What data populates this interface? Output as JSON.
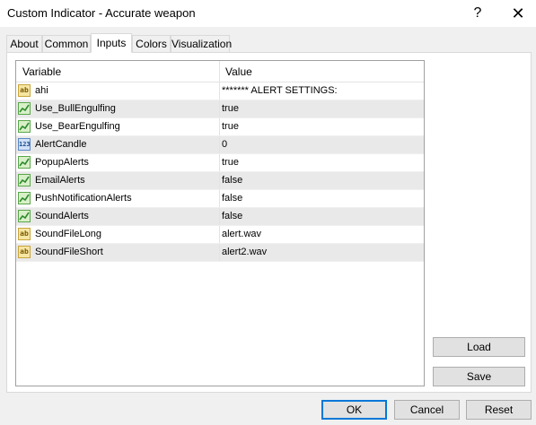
{
  "window": {
    "title": "Custom Indicator - Accurate weapon",
    "help_glyph": "?",
    "close_glyph": "✕"
  },
  "tabs": [
    {
      "label": "About",
      "active": false
    },
    {
      "label": "Common",
      "active": false
    },
    {
      "label": "Inputs",
      "active": true
    },
    {
      "label": "Colors",
      "active": false
    },
    {
      "label": "Visualization",
      "active": false
    }
  ],
  "grid": {
    "headers": {
      "variable": "Variable",
      "value": "Value"
    },
    "rows": [
      {
        "icon": "string-icon",
        "icon_text": "ab",
        "variable": "ahi",
        "value": "******* ALERT SETTINGS:"
      },
      {
        "icon": "bool-icon",
        "icon_text": "",
        "variable": "Use_BullEngulfing",
        "value": "true"
      },
      {
        "icon": "bool-icon",
        "icon_text": "",
        "variable": "Use_BearEngulfing",
        "value": "true"
      },
      {
        "icon": "int-icon",
        "icon_text": "123",
        "variable": "AlertCandle",
        "value": "0"
      },
      {
        "icon": "bool-icon",
        "icon_text": "",
        "variable": "PopupAlerts",
        "value": "true"
      },
      {
        "icon": "bool-icon",
        "icon_text": "",
        "variable": "EmailAlerts",
        "value": "false"
      },
      {
        "icon": "bool-icon",
        "icon_text": "",
        "variable": "PushNotificationAlerts",
        "value": "false"
      },
      {
        "icon": "bool-icon",
        "icon_text": "",
        "variable": "SoundAlerts",
        "value": "false"
      },
      {
        "icon": "string-icon",
        "icon_text": "ab",
        "variable": "SoundFileLong",
        "value": "alert.wav"
      },
      {
        "icon": "string-icon",
        "icon_text": "ab",
        "variable": "SoundFileShort",
        "value": "alert2.wav"
      }
    ]
  },
  "buttons": {
    "load": "Load",
    "save": "Save",
    "ok": "OK",
    "cancel": "Cancel",
    "reset": "Reset"
  },
  "colors": {
    "accent": "#0078d7",
    "row_alt": "#e9e9e9",
    "dialog_bg": "#f0f0f0"
  }
}
